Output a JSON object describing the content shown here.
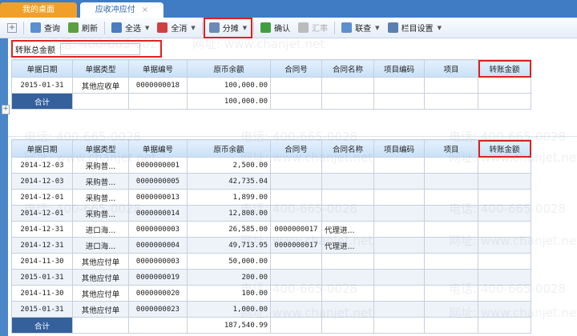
{
  "tabs": [
    {
      "label": "我的桌面"
    },
    {
      "label": "应收冲应付",
      "close": "×"
    }
  ],
  "toolbar": {
    "items": [
      {
        "label": "查询",
        "icon": "search-icon",
        "color": "#5a8fd0"
      },
      {
        "label": "刷新",
        "icon": "refresh-icon",
        "color": "#5aa040"
      },
      {
        "label": "全选",
        "icon": "select-all-icon",
        "color": "#4a7cc0",
        "dropdown": true
      },
      {
        "label": "全消",
        "icon": "deselect-all-icon",
        "color": "#d04040",
        "dropdown": true
      },
      {
        "label": "分摊",
        "icon": "allocate-icon",
        "color": "#6a8ab8",
        "dropdown": true,
        "highlight": true
      },
      {
        "label": "确认",
        "icon": "confirm-icon",
        "color": "#40a040"
      },
      {
        "label": "汇率",
        "icon": "exchange-rate-icon",
        "color": "#bbbbbb",
        "disabled": true
      },
      {
        "label": "联查",
        "icon": "linked-query-icon",
        "color": "#5a8fd0",
        "dropdown": true
      },
      {
        "label": "栏目设置",
        "icon": "column-settings-icon",
        "color": "#5a7fb0",
        "dropdown": true
      }
    ]
  },
  "transfer_total": {
    "label": "转账总金额",
    "value": ""
  },
  "columns": [
    "单据日期",
    "单据类型",
    "单据编号",
    "原币余额",
    "合同号",
    "合同名称",
    "项目编码",
    "项目",
    "转账金额"
  ],
  "table1": {
    "rows": [
      [
        "2015-01-31",
        "其他应收单",
        "0000000018",
        "100,000.00",
        "",
        "",
        "",
        "",
        ""
      ]
    ],
    "total_label": "合计",
    "total": "100,000.00"
  },
  "table2": {
    "rows": [
      [
        "2014-12-03",
        "采购普...",
        "0000000001",
        "2,500.00",
        "",
        "",
        "",
        "",
        ""
      ],
      [
        "2014-12-03",
        "采购普...",
        "0000000005",
        "42,735.04",
        "",
        "",
        "",
        "",
        ""
      ],
      [
        "2014-12-01",
        "采购普...",
        "0000000013",
        "1,899.00",
        "",
        "",
        "",
        "",
        ""
      ],
      [
        "2014-12-01",
        "采购普...",
        "0000000014",
        "12,808.00",
        "",
        "",
        "",
        "",
        ""
      ],
      [
        "2014-12-31",
        "进口海...",
        "0000000003",
        "26,585.00",
        "0000000017",
        "代理进...",
        "",
        "",
        ""
      ],
      [
        "2014-12-31",
        "进口海...",
        "0000000004",
        "49,713.95",
        "0000000017",
        "代理进...",
        "",
        "",
        ""
      ],
      [
        "2014-11-30",
        "其他应付单",
        "0000000003",
        "50,000.00",
        "",
        "",
        "",
        "",
        ""
      ],
      [
        "2015-01-31",
        "其他应付单",
        "0000000019",
        "200.00",
        "",
        "",
        "",
        "",
        ""
      ],
      [
        "2014-11-30",
        "其他应付单",
        "0000000020",
        "100.00",
        "",
        "",
        "",
        "",
        ""
      ],
      [
        "2015-01-31",
        "其他应付单",
        "0000000023",
        "1,000.00",
        "",
        "",
        "",
        "",
        ""
      ]
    ],
    "total_label": "合计",
    "total": "187,540.99"
  },
  "watermark": {
    "phone": "电话: 400-665-0028",
    "site": "网址: www.chanjet.net"
  },
  "colors": {
    "tabbar": "#3f7cc4",
    "home_tab": "#f0a028",
    "highlight": "#e02020",
    "total_cell": "#34609c"
  }
}
